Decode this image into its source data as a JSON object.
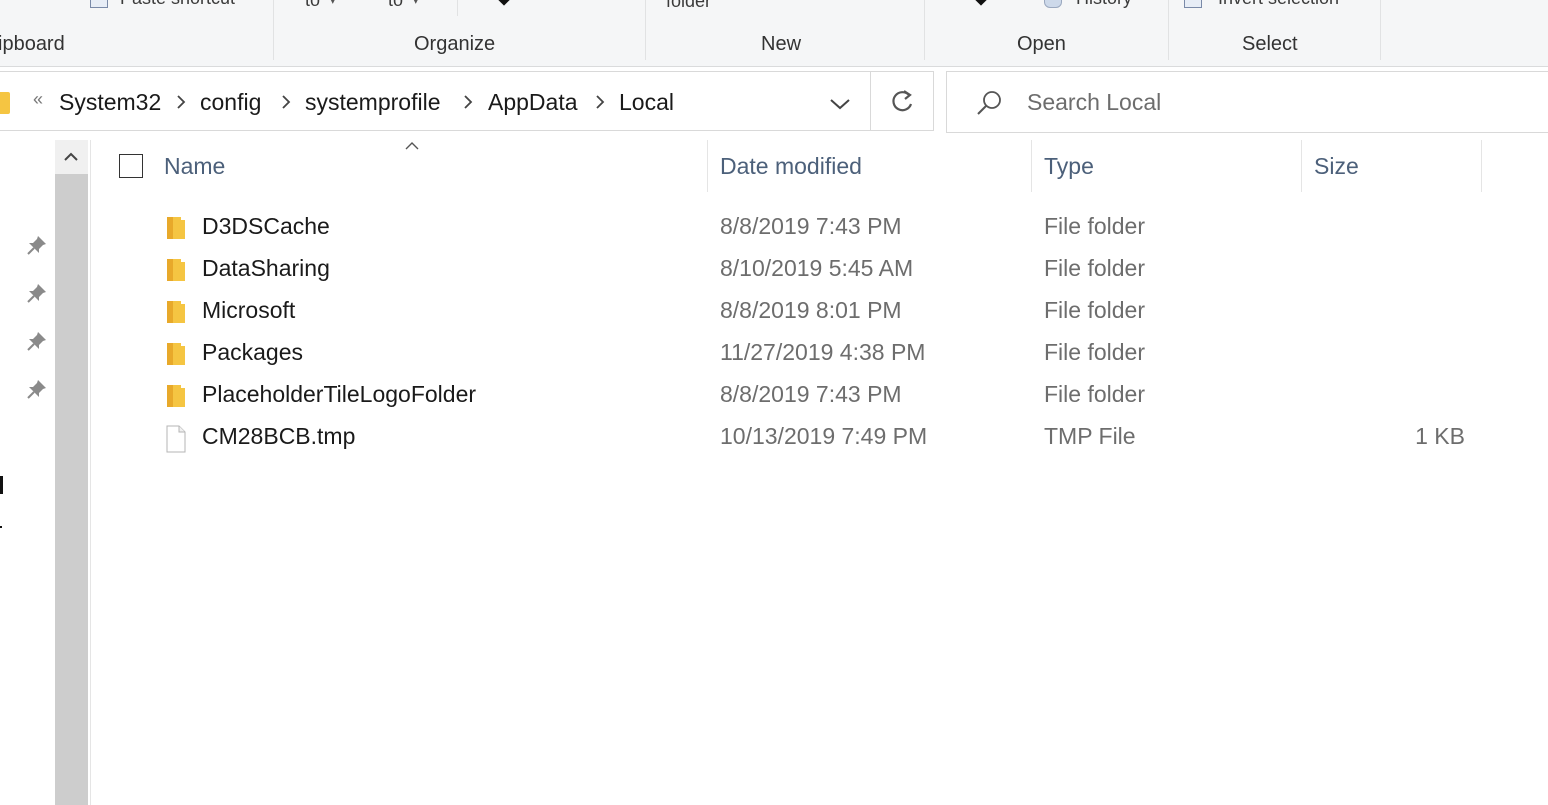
{
  "ribbon": {
    "clipped_top": {
      "paste_shortcut": "Paste shortcut",
      "move_to": "to",
      "copy_to": "to",
      "new_folder": "folder",
      "history": "History",
      "invert_selection": "Invert selection"
    },
    "groups": {
      "clipboard": "ipboard",
      "organize": "Organize",
      "new": "New",
      "open": "Open",
      "select": "Select"
    }
  },
  "address_bar": {
    "overflow_marker": "«",
    "breadcrumbs": [
      "System32",
      "config",
      "systemprofile",
      "AppData",
      "Local"
    ]
  },
  "search": {
    "placeholder": "Search Local"
  },
  "columns": {
    "name": "Name",
    "date_modified": "Date modified",
    "type": "Type",
    "size": "Size"
  },
  "files": [
    {
      "name": "D3DSCache",
      "date": "8/8/2019 7:43 PM",
      "type": "File folder",
      "size": "",
      "icon": "folder-icon"
    },
    {
      "name": "DataSharing",
      "date": "8/10/2019 5:45 AM",
      "type": "File folder",
      "size": "",
      "icon": "folder-icon"
    },
    {
      "name": "Microsoft",
      "date": "8/8/2019 8:01 PM",
      "type": "File folder",
      "size": "",
      "icon": "folder-icon"
    },
    {
      "name": "Packages",
      "date": "11/27/2019 4:38 PM",
      "type": "File folder",
      "size": "",
      "icon": "folder-icon"
    },
    {
      "name": "PlaceholderTileLogoFolder",
      "date": "8/8/2019 7:43 PM",
      "type": "File folder",
      "size": "",
      "icon": "folder-icon"
    },
    {
      "name": "CM28BCB.tmp",
      "date": "10/13/2019 7:49 PM",
      "type": "TMP File",
      "size": "1 KB",
      "icon": "file-icon"
    }
  ],
  "colors": {
    "folder_yellow": "#f5c542",
    "header_text": "#4c607a",
    "secondary_text": "#6d6d6d"
  }
}
